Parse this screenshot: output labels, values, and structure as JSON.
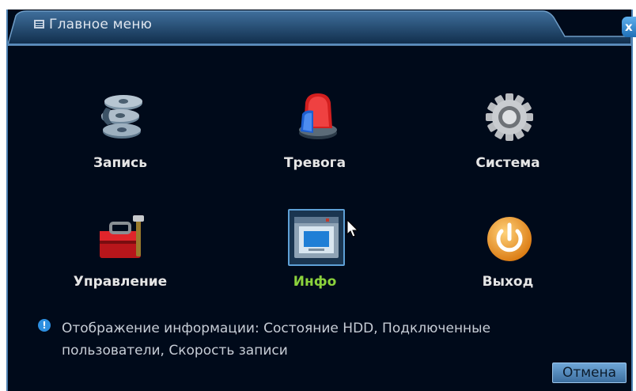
{
  "window": {
    "title": "Главное меню",
    "close_label": "x"
  },
  "menu": [
    {
      "label": "Запись",
      "icon": "film-reels-icon",
      "active": false
    },
    {
      "label": "Тревога",
      "icon": "alarm-siren-icon",
      "active": false
    },
    {
      "label": "Система",
      "icon": "gear-icon",
      "active": false
    },
    {
      "label": "Управление",
      "icon": "toolbox-icon",
      "active": false
    },
    {
      "label": "Инфо",
      "icon": "info-window-icon",
      "active": true
    },
    {
      "label": "Выход",
      "icon": "power-icon",
      "active": false
    }
  ],
  "info": {
    "text": "Отображение информации: Состояние HDD, Подключенные пользователи, Скорость записи"
  },
  "buttons": {
    "cancel": "Отмена"
  },
  "colors": {
    "background": "#000a1a",
    "frame": "#4b7fb0",
    "active_label": "#8bd23c"
  }
}
